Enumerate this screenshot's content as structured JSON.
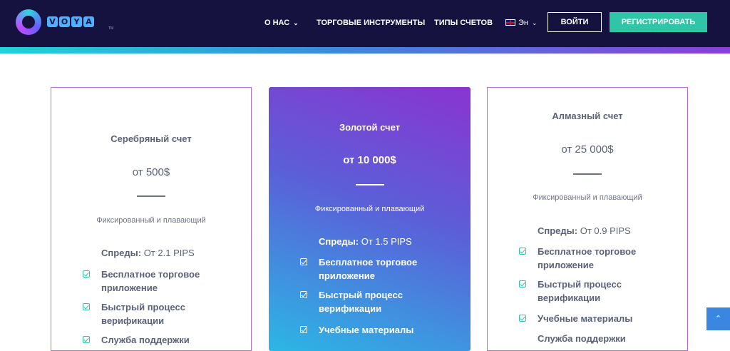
{
  "brand": {
    "letters": [
      "V",
      "O",
      "Y",
      "A"
    ],
    "tm": "TM"
  },
  "nav": {
    "about": "О НАС",
    "instruments": "ТОРГОВЫЕ ИНСТРУМЕНТЫ",
    "accounts": "ТИПЫ СЧЕТОВ",
    "language": "Эн",
    "login": "ВОЙТИ",
    "register": "РЕГИСТРИРОВАТЬ"
  },
  "cards": [
    {
      "title": "Серебряный счет",
      "price": "от 500$",
      "subtitle": "Фиксированный и плавающий",
      "spread_label": "Спреды:",
      "spread_value": " От 2.1 PIPS",
      "features": [
        "Бесплатное торговое приложение",
        "Быстрый процесс верификации",
        "Служба поддержки"
      ]
    },
    {
      "title": "Золотой счет",
      "price": "от 10 000$",
      "subtitle": "Фиксированный и плавающий",
      "spread_label": "Спреды:",
      "spread_value": " От 1.5 PIPS",
      "features": [
        "Бесплатное торговое приложение",
        "Быстрый процесс верификации",
        "Учебные материалы"
      ]
    },
    {
      "title": "Алмазный счет",
      "price": "от 25 000$",
      "subtitle": "Фиксированный и плавающий",
      "spread_label": "Спреды:",
      "spread_value": " От 0.9 PIPS",
      "features": [
        "Бесплатное торговое приложение",
        "Быстрый процесс верификации",
        "Учебные материалы",
        "Служба поддержки"
      ]
    }
  ],
  "colors": {
    "header": "#16123f",
    "accent": "#2fc6a8",
    "text": "#5b6275"
  }
}
